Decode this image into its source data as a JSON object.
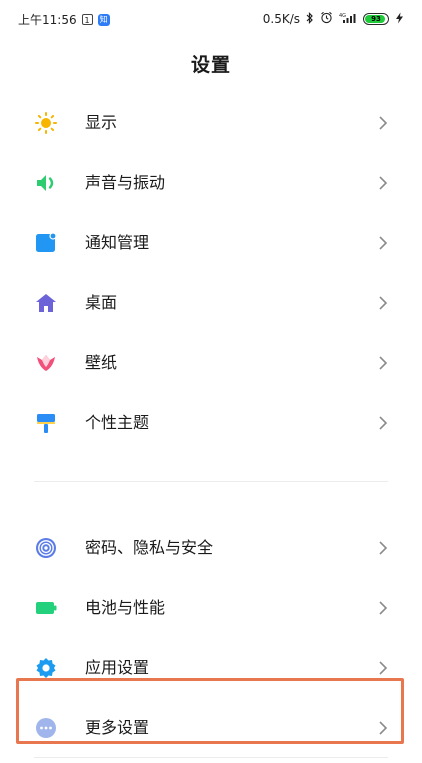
{
  "status_bar": {
    "time": "上午11:56",
    "calendar_day": "1",
    "notification_badge": "知",
    "net_speed": "0.5K/s",
    "battery_level": "93",
    "battery_fraction": 0.93,
    "icons": [
      "bluetooth-icon",
      "alarm-icon",
      "signal-4g-icon",
      "battery-icon",
      "charging-icon"
    ]
  },
  "header": {
    "title": "设置"
  },
  "menu": {
    "items": [
      {
        "label": "显示",
        "icon": "display-sun-icon",
        "color": "#f7b500"
      },
      {
        "label": "声音与振动",
        "icon": "speaker-icon",
        "color": "#2ecc71"
      },
      {
        "label": "通知管理",
        "icon": "notification-icon",
        "color": "#2196f3"
      },
      {
        "label": "桌面",
        "icon": "home-icon",
        "color": "#6c63d9"
      },
      {
        "label": "壁纸",
        "icon": "tulip-icon",
        "color": "#f0507a"
      },
      {
        "label": "个性主题",
        "icon": "paint-roller-icon",
        "color": "#2a8cf5"
      },
      {
        "label": "密码、隐私与安全",
        "icon": "fingerprint-icon",
        "color": "#5b7ce6"
      },
      {
        "label": "电池与性能",
        "icon": "battery-icon",
        "color": "#23d07c"
      },
      {
        "label": "应用设置",
        "icon": "gear-icon",
        "color": "#1c9cf0"
      },
      {
        "label": "更多设置",
        "icon": "more-dots-icon",
        "color": "#9fb5ec"
      }
    ]
  },
  "colors": {
    "highlight_border": "#e8764e",
    "chevron": "#8a8a8a"
  }
}
